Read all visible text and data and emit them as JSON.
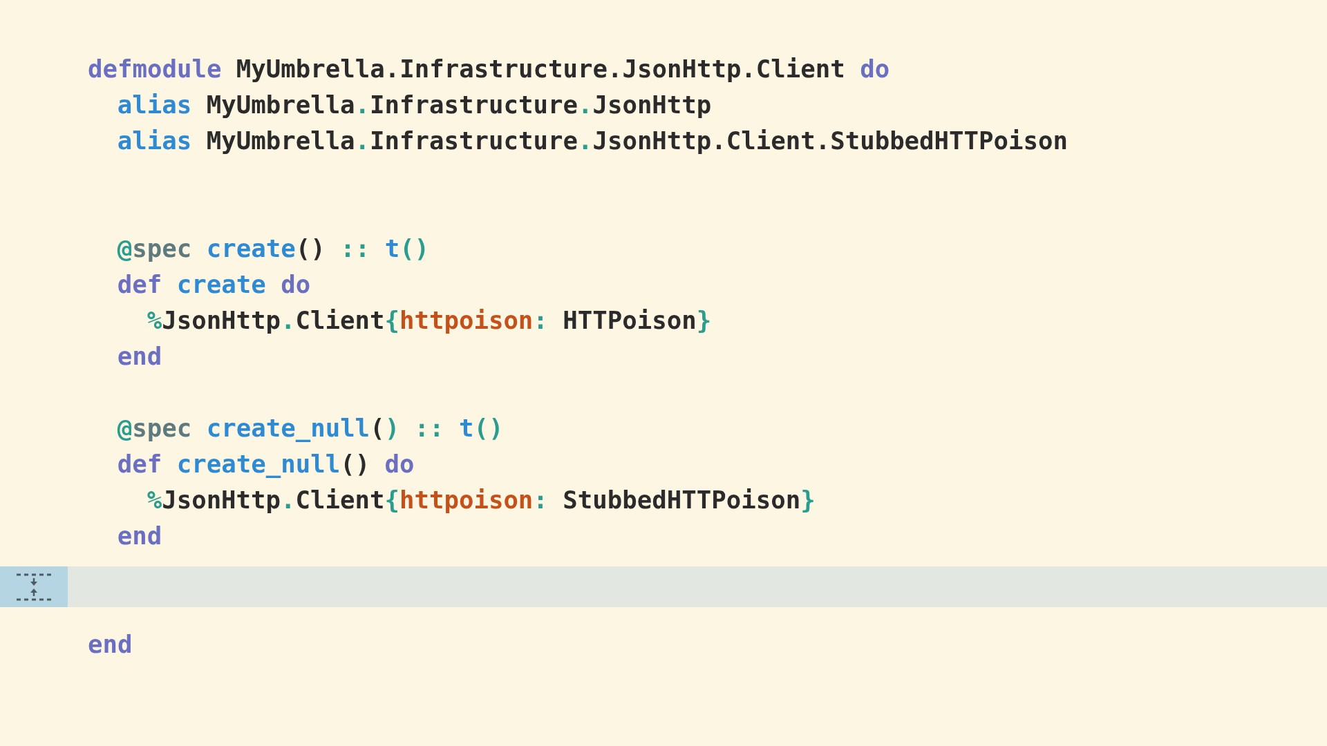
{
  "editor": {
    "lines": [
      {
        "kind": "code",
        "tokens": [
          {
            "kind": "keyword",
            "text": "defmodule"
          },
          {
            "kind": "plain",
            "text": " MyUmbrella.Infrastructure.JsonHttp.Client"
          },
          {
            "kind": "keyword",
            "text": " do"
          }
        ],
        "children": [
          {
            "kind": "code",
            "tokens": [
              {
                "kind": "function",
                "text": "alias"
              },
              {
                "kind": "plain",
                "text": " MyUmbrella"
              },
              {
                "kind": "punct",
                "text": "."
              },
              {
                "kind": "plain",
                "text": "Infrastructure"
              },
              {
                "kind": "punct",
                "text": "."
              },
              {
                "kind": "plain",
                "text": "JsonHttp"
              }
            ]
          },
          {
            "kind": "code",
            "tokens": [
              {
                "kind": "function",
                "text": "alias"
              },
              {
                "kind": "plain",
                "text": " MyUmbrella"
              },
              {
                "kind": "punct",
                "text": "."
              },
              {
                "kind": "plain",
                "text": "Infrastructure"
              },
              {
                "kind": "punct",
                "text": "."
              },
              {
                "kind": "plain",
                "text": "JsonHttp.Client.StubbedHTTPoison"
              }
            ]
          },
          {
            "kind": "blank"
          },
          {
            "kind": "blank"
          },
          {
            "kind": "code",
            "tokens": [
              {
                "kind": "punct",
                "text": "@"
              },
              {
                "kind": "attribute",
                "text": "spec"
              },
              {
                "kind": "function",
                "text": " create"
              },
              {
                "kind": "plain",
                "text": "()"
              },
              {
                "kind": "punct",
                "text": " ::"
              },
              {
                "kind": "function",
                "text": " t"
              },
              {
                "kind": "punct",
                "text": "()"
              }
            ]
          },
          {
            "kind": "code",
            "tokens": [
              {
                "kind": "keyword",
                "text": "def"
              },
              {
                "kind": "function",
                "text": " create"
              },
              {
                "kind": "keyword",
                "text": " do"
              }
            ],
            "children": [
              {
                "kind": "code",
                "tokens": [
                  {
                    "kind": "punct",
                    "text": "%"
                  },
                  {
                    "kind": "plain",
                    "text": "JsonHttp"
                  },
                  {
                    "kind": "punct",
                    "text": "."
                  },
                  {
                    "kind": "plain",
                    "text": "Client"
                  },
                  {
                    "kind": "punct",
                    "text": "{"
                  },
                  {
                    "kind": "atom",
                    "text": "httpoison"
                  },
                  {
                    "kind": "punct",
                    "text": ":"
                  },
                  {
                    "kind": "plain",
                    "text": " HTTPoison"
                  },
                  {
                    "kind": "punct",
                    "text": "}"
                  }
                ]
              }
            ]
          },
          {
            "kind": "code",
            "tokens": [
              {
                "kind": "keyword",
                "text": "end"
              }
            ]
          },
          {
            "kind": "blank"
          },
          {
            "kind": "code",
            "tokens": [
              {
                "kind": "punct",
                "text": "@"
              },
              {
                "kind": "attribute",
                "text": "spec"
              },
              {
                "kind": "function",
                "text": " create_null"
              },
              {
                "kind": "plain",
                "text": "("
              },
              {
                "kind": "punct",
                "text": ")"
              },
              {
                "kind": "punct",
                "text": " ::"
              },
              {
                "kind": "function",
                "text": " t"
              },
              {
                "kind": "punct",
                "text": "()"
              }
            ]
          },
          {
            "kind": "code",
            "tokens": [
              {
                "kind": "keyword",
                "text": "def"
              },
              {
                "kind": "function",
                "text": " create_null"
              },
              {
                "kind": "plain",
                "text": "()"
              },
              {
                "kind": "keyword",
                "text": " do"
              }
            ],
            "children": [
              {
                "kind": "code",
                "tokens": [
                  {
                    "kind": "punct",
                    "text": "%"
                  },
                  {
                    "kind": "plain",
                    "text": "JsonHttp"
                  },
                  {
                    "kind": "punct",
                    "text": "."
                  },
                  {
                    "kind": "plain",
                    "text": "Client"
                  },
                  {
                    "kind": "punct",
                    "text": "{"
                  },
                  {
                    "kind": "atom",
                    "text": "httpoison"
                  },
                  {
                    "kind": "punct",
                    "text": ":"
                  },
                  {
                    "kind": "plain",
                    "text": " StubbedHTTPoison"
                  },
                  {
                    "kind": "punct",
                    "text": "}"
                  }
                ]
              }
            ]
          },
          {
            "kind": "code",
            "tokens": [
              {
                "kind": "keyword",
                "text": "end"
              }
            ]
          },
          {
            "kind": "fold"
          }
        ]
      },
      {
        "kind": "code",
        "tokens": [
          {
            "kind": "keyword",
            "text": "end"
          }
        ]
      }
    ]
  }
}
